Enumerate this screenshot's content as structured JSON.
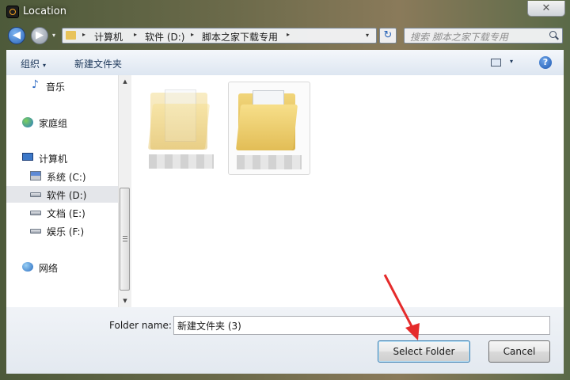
{
  "window": {
    "title": "Location",
    "close_glyph": "✕"
  },
  "address_bar": {
    "path": [
      "计算机",
      "软件 (D:)",
      "脚本之家下载专用"
    ],
    "separator_glyph": "▸",
    "dropdown_glyph": "▾",
    "refresh_glyph": "↻"
  },
  "search": {
    "placeholder": "搜索 脚本之家下载专用",
    "icon": "search-icon"
  },
  "toolbar": {
    "organize_label": "组织",
    "organize_caret": "▾",
    "new_folder_label": "新建文件夹",
    "view_caret": "▾",
    "help_glyph": "?"
  },
  "nav_pane": {
    "items": [
      {
        "label": "音乐",
        "icon": "music-icon"
      },
      {
        "label": "家庭组",
        "icon": "homegroup-icon"
      },
      {
        "label": "计算机",
        "icon": "computer-icon"
      },
      {
        "label": "系统 (C:)",
        "icon": "system-drive-icon"
      },
      {
        "label": "软件 (D:)",
        "icon": "drive-icon",
        "selected": true
      },
      {
        "label": "文档 (E:)",
        "icon": "drive-icon"
      },
      {
        "label": "娱乐 (F:)",
        "icon": "drive-icon"
      },
      {
        "label": "网络",
        "icon": "network-icon"
      }
    ]
  },
  "scrollbar": {
    "up_glyph": "▲",
    "down_glyph": "▼"
  },
  "files": {
    "count_visible": 2
  },
  "footer": {
    "folder_name_label": "Folder name:",
    "folder_name_value": "新建文件夹 (3)",
    "select_button": "Select Folder",
    "cancel_button": "Cancel"
  },
  "colors": {
    "accent_arrow": "#e52b2b",
    "selection_bg": "#e4e6ea",
    "toolbar_text": "#1e395b"
  }
}
